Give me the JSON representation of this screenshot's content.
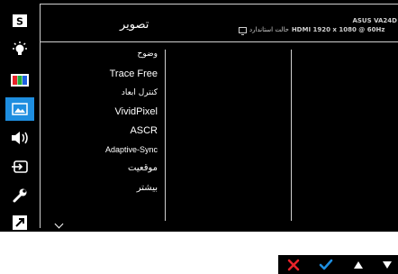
{
  "header": {
    "title": "تصویر",
    "model": "ASUS VA24D",
    "status_mode": "حالت استاندارد",
    "signal": "HDMI 1920 x 1080 @ 60Hz"
  },
  "sidebar": {
    "items": [
      {
        "icon": "splendid-icon",
        "glyph": "S"
      },
      {
        "icon": "eye-care-icon"
      },
      {
        "icon": "color-icon"
      },
      {
        "icon": "image-icon",
        "active": true
      },
      {
        "icon": "sound-icon"
      },
      {
        "icon": "input-select-icon"
      },
      {
        "icon": "system-setup-icon"
      },
      {
        "icon": "shortcut-icon"
      }
    ]
  },
  "menu": {
    "items": [
      {
        "label": "وضوح"
      },
      {
        "label": "Trace Free"
      },
      {
        "label": "کنترل ابعاد"
      },
      {
        "label": "VividPixel"
      },
      {
        "label": "ASCR"
      },
      {
        "label": "Adaptive-Sync"
      },
      {
        "label": "موقعیت"
      },
      {
        "label": "بیشتر"
      }
    ]
  },
  "colors": {
    "accent": "#1e8ee0",
    "close": "#e8232a",
    "confirm": "#1e8ee0",
    "text": "#ffffff",
    "background": "#000000"
  },
  "nav": [
    {
      "icon": "close-icon"
    },
    {
      "icon": "check-icon"
    },
    {
      "icon": "up-arrow-icon"
    },
    {
      "icon": "down-arrow-icon"
    }
  ]
}
